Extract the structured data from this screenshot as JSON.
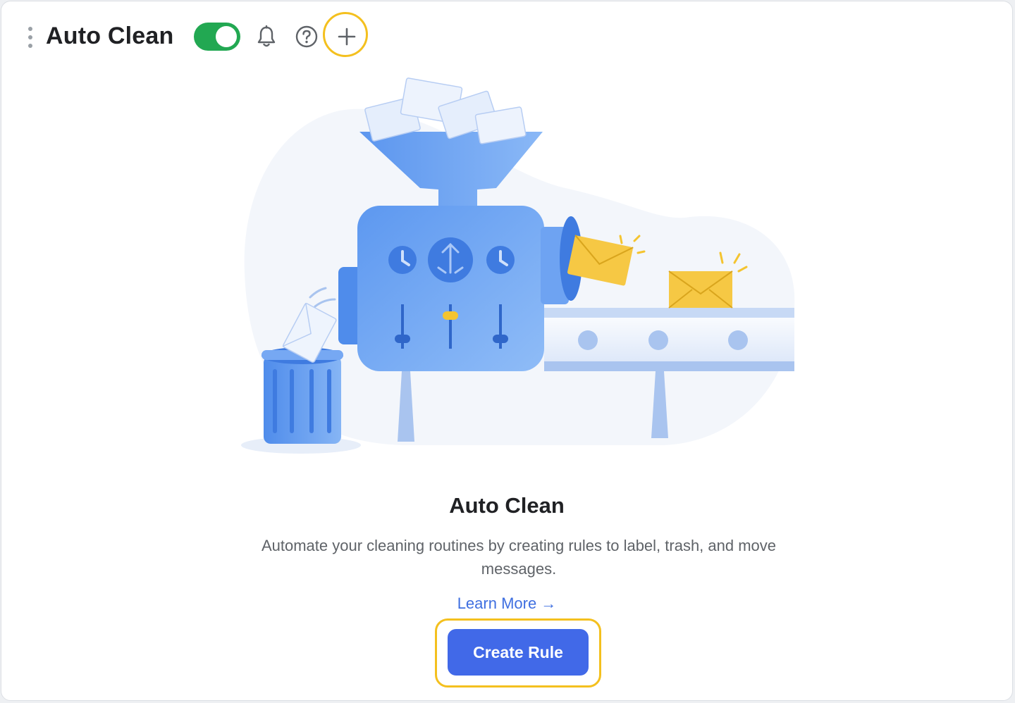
{
  "header": {
    "title": "Auto Clean",
    "toggle_on": true,
    "toggle_color": "#22a852",
    "icons": [
      "drag-handle-icon",
      "bell-icon",
      "help-circle-icon",
      "plus-icon"
    ]
  },
  "empty_state": {
    "title": "Auto Clean",
    "description": "Automate your cleaning routines by creating rules to label, trash, and move messages.",
    "learn_more": "Learn More →",
    "cta_label": "Create Rule",
    "cta_color": "#4169e8",
    "highlight_color": "#f4c01e"
  }
}
